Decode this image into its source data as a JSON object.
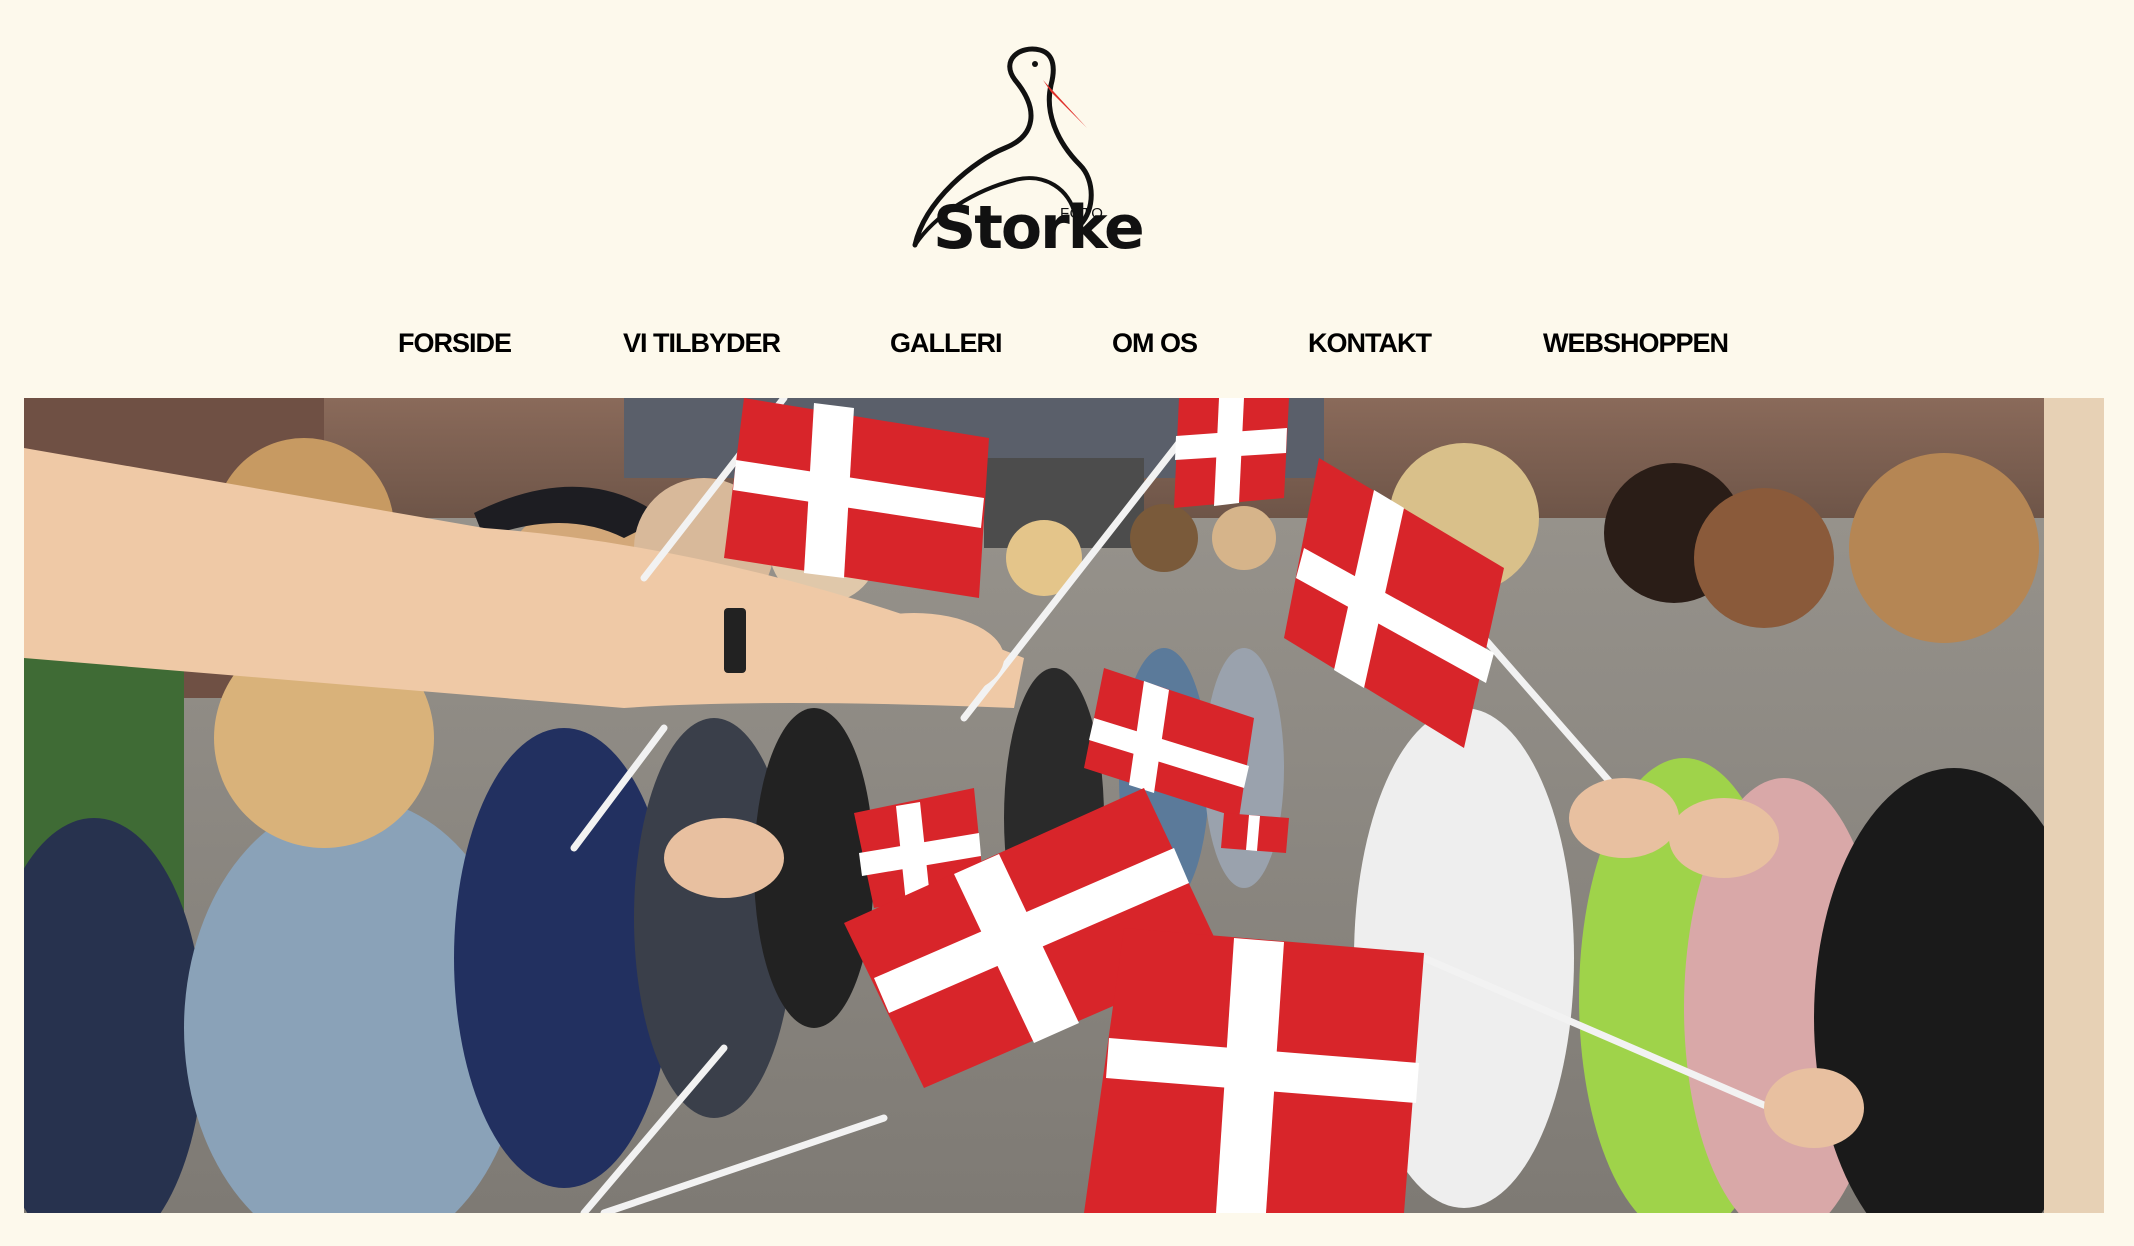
{
  "site": {
    "logo_name": "Storke",
    "logo_tagline": "FOTO",
    "brand_color": "#e0302a"
  },
  "nav": {
    "items": [
      {
        "label": "FORSIDE"
      },
      {
        "label": "VI TILBYDER"
      },
      {
        "label": "GALLERI"
      },
      {
        "label": "OM OS"
      },
      {
        "label": "KONTAKT"
      },
      {
        "label": "WEBSHOPPEN"
      }
    ]
  },
  "hero": {
    "icon": "photo",
    "subject": "children waving Danish flags"
  },
  "colors": {
    "background": "#fdf9ec",
    "text": "#000000",
    "flag_red": "#d8252a",
    "flag_white": "#ffffff"
  }
}
